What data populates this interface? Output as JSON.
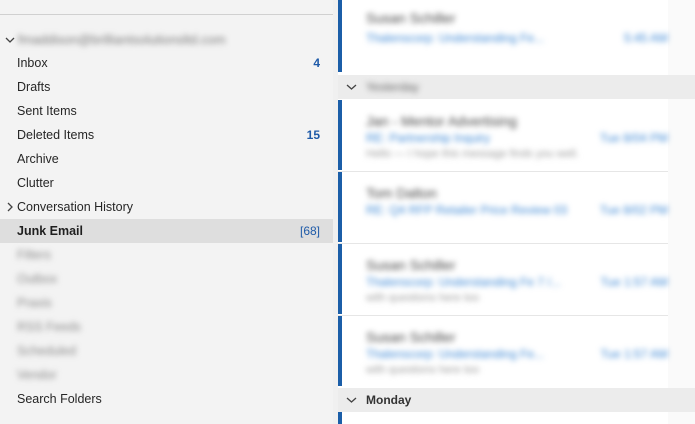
{
  "account": {
    "name": "fmaddison@brilliantsolutionsltd.com"
  },
  "folders": [
    {
      "label": "Inbox",
      "count": "4"
    },
    {
      "label": "Drafts",
      "count": ""
    },
    {
      "label": "Sent Items",
      "count": ""
    },
    {
      "label": "Deleted Items",
      "count": "15"
    },
    {
      "label": "Archive",
      "count": ""
    },
    {
      "label": "Clutter",
      "count": ""
    },
    {
      "label": "Conversation History",
      "count": ""
    },
    {
      "label": "Junk Email",
      "count": "[68]"
    },
    {
      "label": "Filters",
      "count": ""
    },
    {
      "label": "Outbox",
      "count": ""
    },
    {
      "label": "Praxis",
      "count": ""
    },
    {
      "label": "RSS Feeds",
      "count": ""
    },
    {
      "label": "Scheduled",
      "count": ""
    },
    {
      "label": "Vendor",
      "count": ""
    },
    {
      "label": "Search Folders",
      "count": ""
    }
  ],
  "messages": [
    {
      "sender": "Susan Schiller",
      "subject": "Thalenscorp: Understanding Fe...",
      "time": "5:45 AM",
      "preview": ""
    },
    {
      "sender": "Jan - Mentor Advertising",
      "subject": "RE: Partnership Inquiry",
      "time": "Tue 8/04 PM",
      "preview": "Hello — I hope this message finds you well."
    },
    {
      "sender": "Tom Dalton",
      "subject": "RE: Q4 RFP Retailer Price Review 03",
      "time": "Tue 8/02 PM",
      "preview": ""
    },
    {
      "sender": "Susan Schiller",
      "subject": "Thalenscorp: Understanding Fe 7 /...",
      "time": "Tue 1:57 AM",
      "preview": "with questions here too"
    },
    {
      "sender": "Susan Schiller",
      "subject": "Thalenscorp: Understanding Fe...",
      "time": "Tue 1:57 AM",
      "preview": "with questions here too"
    }
  ],
  "groups": [
    {
      "label": "Yesterday"
    },
    {
      "label": "Monday"
    }
  ],
  "colors": {
    "accent": "#1b5ea8",
    "selected_bg": "#dedede",
    "pane_bg": "#f3f3f3"
  }
}
